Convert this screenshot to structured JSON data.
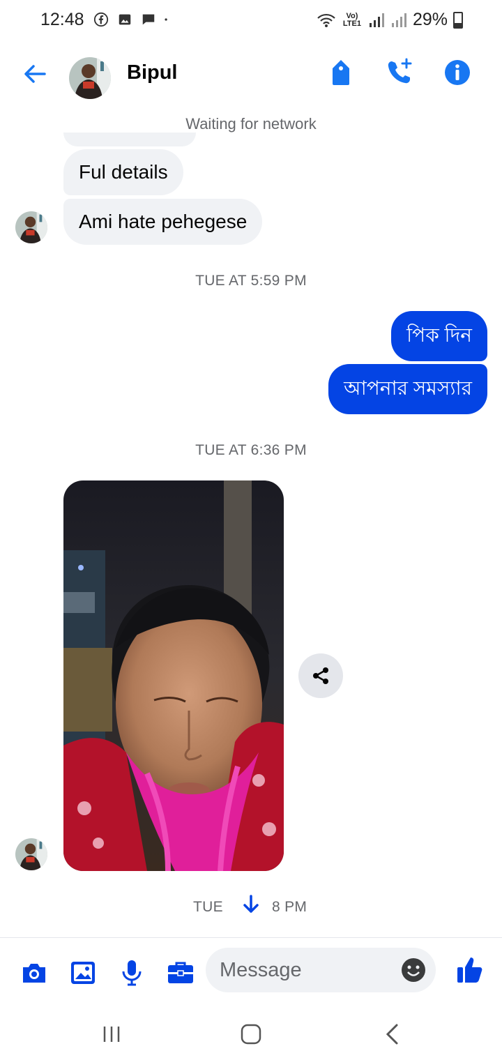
{
  "status_bar": {
    "time": "12:48",
    "network_label": "Vo) LTE1",
    "battery": "29%"
  },
  "header": {
    "contact_name": "Bipul"
  },
  "network_notice": "Waiting for network",
  "messages": {
    "incoming": [
      {
        "text": "Ful details"
      },
      {
        "text": "Ami hate pehegese"
      }
    ],
    "timestamp_1": "TUE AT 5:59 PM",
    "outgoing": [
      {
        "text": "পিক দিন"
      },
      {
        "text": "আপনার সমস্যার"
      }
    ],
    "timestamp_2": "TUE AT 6:36 PM",
    "timestamp_3_left": "TUE ",
    "timestamp_3_right": "8 PM"
  },
  "composer": {
    "placeholder": "Message"
  },
  "colors": {
    "accent": "#0444e4",
    "header_icon": "#1877f2",
    "incoming_bubble": "#f0f2f5",
    "muted_text": "#65676b"
  },
  "icons": {
    "back": "arrow-left-icon",
    "tag": "tag-icon",
    "call": "phone-add-icon",
    "info": "info-icon",
    "share": "share-icon",
    "camera": "camera-icon",
    "gallery": "image-icon",
    "mic": "microphone-icon",
    "toolbox": "briefcase-icon",
    "emoji": "emoji-icon",
    "like": "thumbs-up-icon",
    "scroll": "arrow-down-icon"
  }
}
